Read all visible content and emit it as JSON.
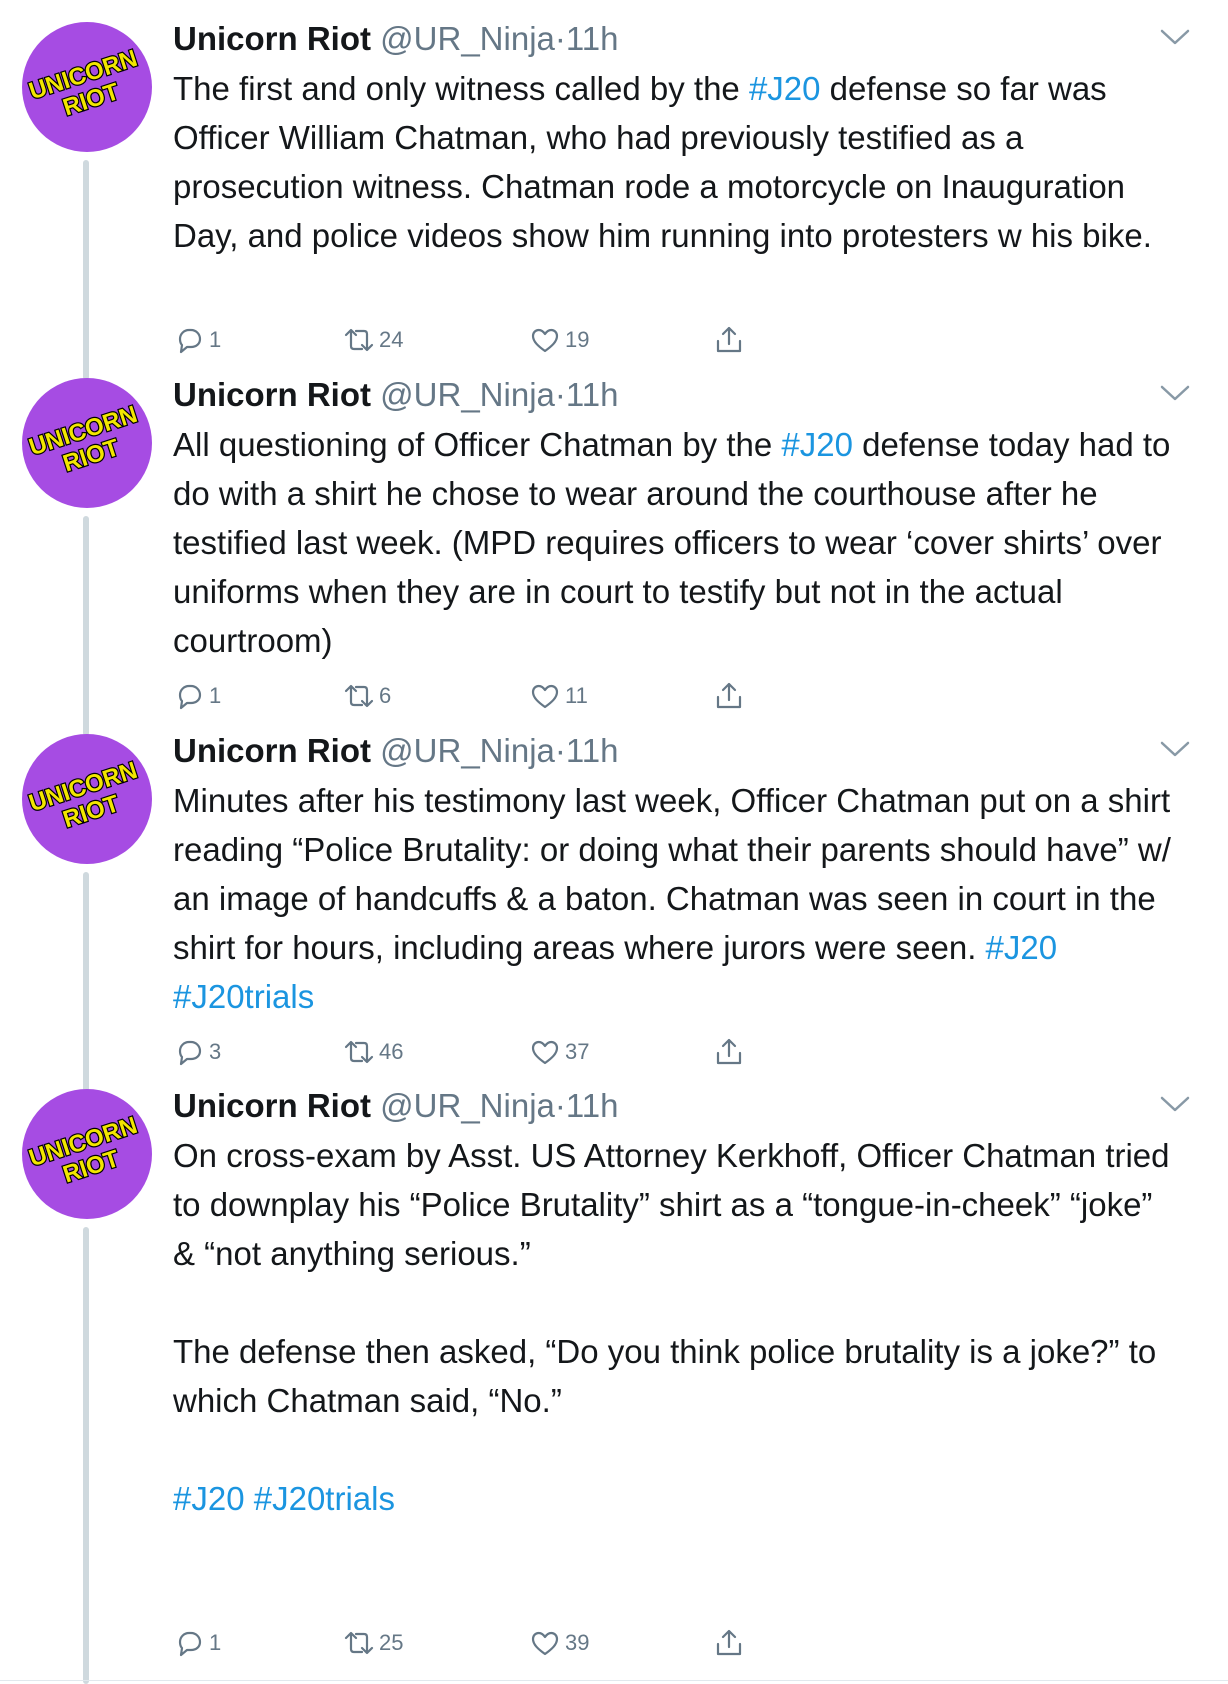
{
  "tweets": [
    {
      "name": "Unicorn Riot",
      "handle": "@UR_Ninja",
      "separator": "·",
      "time": "11h",
      "avatar_text": [
        "UNICORN",
        "RIOT"
      ],
      "segments": [
        {
          "t": "The first and only witness called by the "
        },
        {
          "t": "#J20",
          "h": true
        },
        {
          "t": " defense so far was Officer William Chatman, who had previously testified as a prosecution witness. Chatman rode a motorcycle on Inauguration Day, and police videos show him running into protesters w his bike."
        }
      ],
      "replies": "1",
      "retweets": "24",
      "likes": "19"
    },
    {
      "name": "Unicorn Riot",
      "handle": "@UR_Ninja",
      "separator": "·",
      "time": "11h",
      "avatar_text": [
        "UNICORN",
        "RIOT"
      ],
      "segments": [
        {
          "t": "All questioning of Officer Chatman by the "
        },
        {
          "t": "#J20",
          "h": true
        },
        {
          "t": " defense today had to do with a shirt he chose to wear around the courthouse after he testified last week. (MPD requires officers to wear ‘cover shirts’ over uniforms when they are in court to testify but not in the actual courtroom)"
        }
      ],
      "replies": "1",
      "retweets": "6",
      "likes": "11"
    },
    {
      "name": "Unicorn Riot",
      "handle": "@UR_Ninja",
      "separator": "·",
      "time": "11h",
      "avatar_text": [
        "UNICORN",
        "RIOT"
      ],
      "segments": [
        {
          "t": "Minutes after his testimony last week, Officer Chatman put on a shirt reading “Police Brutality: or doing what their parents should have” w/ an image of handcuffs & a baton. Chatman was seen in court in the shirt for hours, including areas where jurors were seen. "
        },
        {
          "t": "#J20",
          "h": true
        },
        {
          "t": " "
        },
        {
          "t": "#J20trials",
          "h": true
        }
      ],
      "replies": "3",
      "retweets": "46",
      "likes": "37"
    },
    {
      "name": "Unicorn Riot",
      "handle": "@UR_Ninja",
      "separator": "·",
      "time": "11h",
      "avatar_text": [
        "UNICORN",
        "RIOT"
      ],
      "segments": [
        {
          "t": "On cross-exam by Asst. US Attorney Kerkhoff, Officer Chatman tried to downplay his “Police Brutality” shirt as a “tongue-in-cheek” “joke” & “not anything serious.”\n\nThe defense then asked, “Do you think police brutality is a joke?” to which Chatman said, “No.”\n\n"
        },
        {
          "t": "#J20",
          "h": true
        },
        {
          "t": " "
        },
        {
          "t": "#J20trials",
          "h": true
        }
      ],
      "replies": "1",
      "retweets": "25",
      "likes": "39"
    }
  ],
  "colors": {
    "avatar_bg": "#a64ce3",
    "avatar_text": "#f2e600",
    "hashtag": "#1b95e0",
    "muted": "#657786",
    "thread_line": "#cfd9de"
  },
  "icons": [
    "reply-icon",
    "retweet-icon",
    "like-icon",
    "share-icon",
    "chevron-down-icon"
  ]
}
